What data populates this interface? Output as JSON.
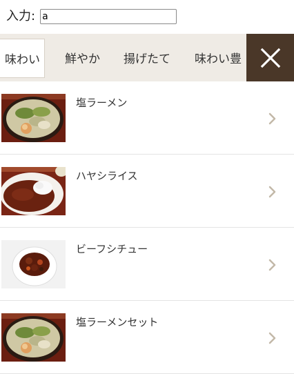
{
  "input": {
    "label": "入力:",
    "value": "a"
  },
  "tabs": [
    {
      "label": "味わい",
      "active": true
    },
    {
      "label": "鮮やか",
      "active": false
    },
    {
      "label": "揚げたて",
      "active": false
    },
    {
      "label": "味わい豊",
      "active": false
    }
  ],
  "close_icon": "close-icon",
  "chevron_icon": "chevron-right-icon",
  "colors": {
    "tab_bar_bg": "#efebe5",
    "close_button_bg": "#4a3728",
    "chevron": "#c2b8a8"
  },
  "items": [
    {
      "title": "塩ラーメン",
      "image": "ramen-photo"
    },
    {
      "title": "ハヤシライス",
      "image": "hayashi-rice-photo"
    },
    {
      "title": "ビーフシチュー",
      "image": "beef-stew-photo"
    },
    {
      "title": "塩ラーメンセット",
      "image": "ramen-set-photo"
    }
  ]
}
